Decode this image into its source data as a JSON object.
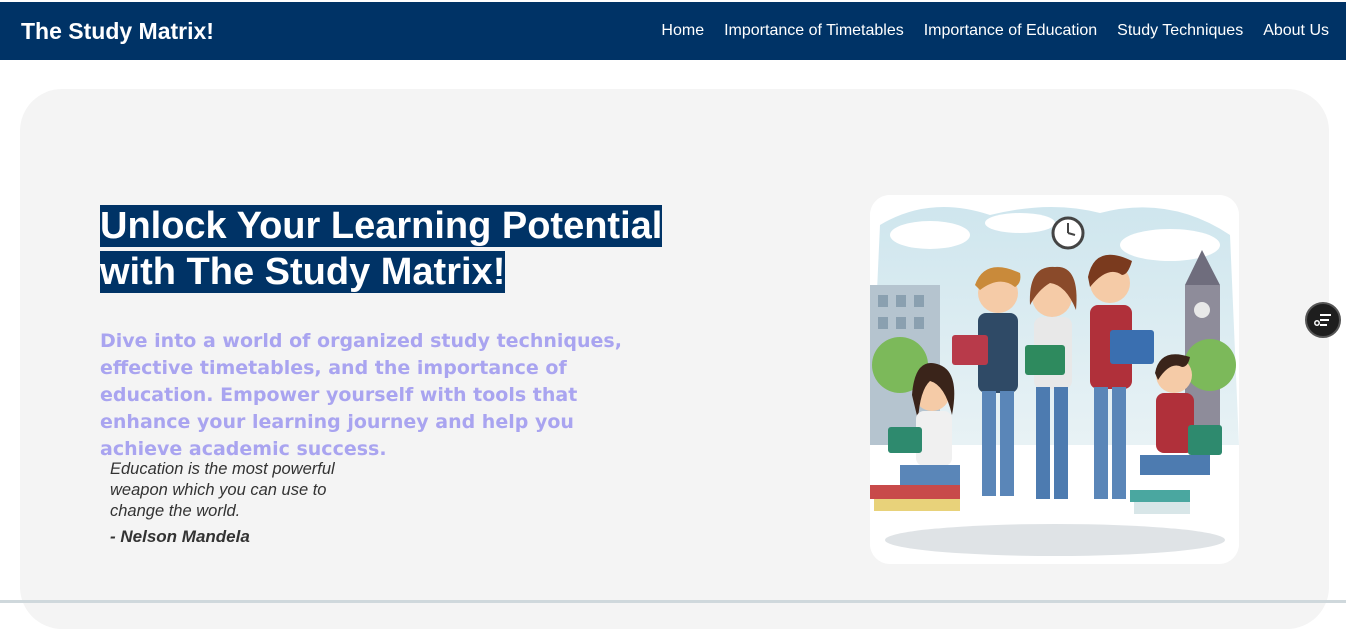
{
  "navbar": {
    "brand": "The Study Matrix!",
    "links": [
      "Home",
      "Importance of Timetables",
      "Importance of Education",
      "Study Techniques",
      "About Us"
    ]
  },
  "hero": {
    "headline_line1": "Unlock Your Learning Potential",
    "headline_line2": "with The Study Matrix!",
    "subtext": "Dive into a world of organized study techniques, effective timetables, and the importance of education. Empower yourself with tools that enhance your learning journey and help you achieve academic success.",
    "quote": "Education is the most powerful weapon which you can use to change the world.",
    "author": "- Nelson Mandela"
  },
  "icons": {
    "fab": "filter-list-icon"
  },
  "colors": {
    "nav_bg": "#003366",
    "headline_bg": "#003366",
    "subtext": "#a9a4f0",
    "hero_bg": "#f4f4f4"
  }
}
